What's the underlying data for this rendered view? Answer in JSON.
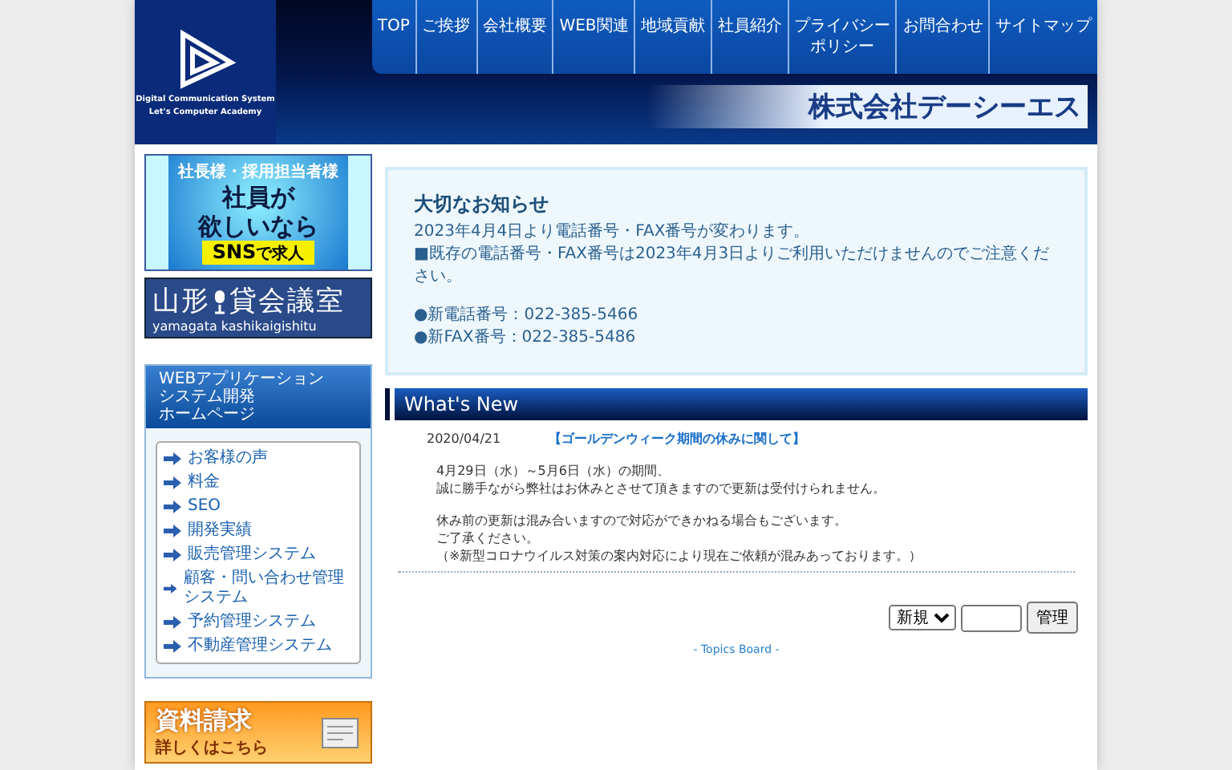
{
  "header": {
    "logo_tagline": [
      "Digital Communication System",
      "Let's Computer Academy"
    ],
    "nav": [
      {
        "lines": [
          "TOP"
        ]
      },
      {
        "lines": [
          "ご挨拶"
        ]
      },
      {
        "lines": [
          "会社概要"
        ]
      },
      {
        "lines": [
          "WEB関連"
        ]
      },
      {
        "lines": [
          "地域貢献"
        ]
      },
      {
        "lines": [
          "社員紹介"
        ]
      },
      {
        "lines": [
          "プライバシー",
          "ポリシー"
        ]
      },
      {
        "lines": [
          "お問合わせ"
        ]
      },
      {
        "lines": [
          "サイトマップ"
        ]
      }
    ],
    "company_name": "株式会社デーシーエス"
  },
  "sidebar": {
    "sns_banner": {
      "top": "社長様・採用担当者様",
      "main": [
        "社員が",
        "欲しいなら"
      ],
      "sns": "SNS",
      "sns_suffix": "で求人"
    },
    "room_banner": {
      "title_left": "山形",
      "title_right": "貸会議室",
      "subtitle": "yamagata kashikaigishitu"
    },
    "menu": {
      "heading": [
        "WEBアプリケーション",
        "システム開発",
        "ホームページ"
      ],
      "items": [
        "お客様の声",
        "料金",
        "SEO",
        "開発実績",
        "販売管理システム",
        "顧客・問い合わせ管理システム",
        "予約管理システム",
        "不動産管理システム"
      ]
    },
    "doc_banner": {
      "title": "資料請求",
      "subtitle": "詳しくはこちら"
    }
  },
  "notice": {
    "title": "大切なお知らせ",
    "paragraphs": [
      [
        "2023年4月4日より電話番号・FAX番号が変わります。",
        "■既存の電話番号・FAX番号は2023年4月3日よりご利用いただけませんのでご注意ください。"
      ],
      [
        "●新電話番号：022-385-5466",
        "●新FAX番号：022-385-5486"
      ]
    ]
  },
  "whats_new": {
    "title": "What's New",
    "posts": [
      {
        "date": "2020/04/21",
        "title": "【ゴールデンウィーク期間の休みに関して】",
        "paragraphs": [
          [
            "4月29日（水）～5月6日（水）の期間、",
            "誠に勝手ながら弊社はお休みとさせて頂きますので更新は受付けられません。"
          ],
          [
            "休み前の更新は混み合いますので対応ができかねる場合もございます。",
            "ご了承ください。",
            "（※新型コロナウイルス対策の案内対応により現在ご依頼が混みあっております。）"
          ]
        ]
      }
    ],
    "form": {
      "select_value": "新規",
      "button": "管理"
    },
    "footer": "- Topics Board -"
  }
}
